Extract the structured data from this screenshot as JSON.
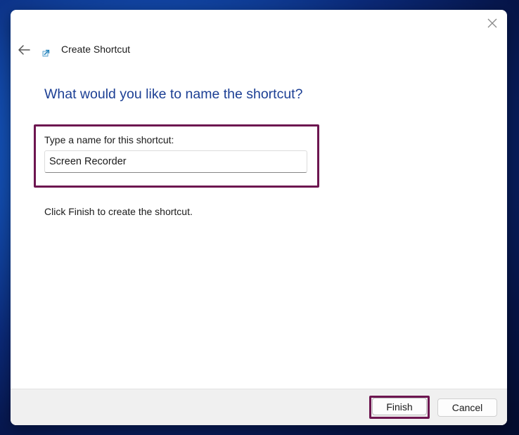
{
  "dialog": {
    "title": "Create Shortcut",
    "heading": "What would you like to name the shortcut?",
    "field_label": "Type a name for this shortcut:",
    "name_input_value": "Screen Recorder",
    "info_text": "Click Finish to create the shortcut.",
    "icons": {
      "close": "close-icon",
      "back": "arrow-left-icon",
      "app": "shortcut-icon"
    }
  },
  "footer": {
    "finish_label": "Finish",
    "cancel_label": "Cancel"
  },
  "colors": {
    "heading": "#1c3f94",
    "highlight": "#6d1650",
    "footer_bg": "#f0f0f0"
  }
}
